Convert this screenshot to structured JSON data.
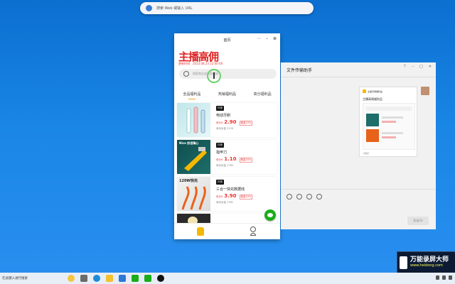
{
  "topbar": {
    "placeholder": "搜索 Web 或输入 URL"
  },
  "miniprogram": {
    "window_title": "首页",
    "logo": "主播高佣",
    "subtitle": "更新时间：2023.08.23 22:00:00",
    "search_placeholder": "搜索商品或粘贴链接",
    "tabs": [
      "全品福利品",
      "热销福利品",
      "高分福利品"
    ],
    "products": [
      {
        "badge": "抖音",
        "name": "电动牙刷",
        "price_label": "低价¥",
        "price": "2.90",
        "commission": "佣金10%",
        "sales": "库存余量 2228",
        "image_overlay": ""
      },
      {
        "badge": "抖音",
        "name": "指甲刀",
        "price_label": "低价¥",
        "price": "1.10",
        "commission": "佣金15%",
        "sales": "库存余量 1780",
        "image_overlay": "Nice 舒适精心"
      },
      {
        "badge": "抖音",
        "name": "三合一快充数据线",
        "price_label": "低价¥",
        "price": "3.90",
        "commission": "佣金10%",
        "sales": "库存余量 1382",
        "image_overlay": "120W快充"
      }
    ]
  },
  "chat": {
    "title": "文件传输助手",
    "card_header": "主播高佣福利品",
    "card_title": "主播高佣福利品",
    "card_footer": "小程序",
    "send_label": "发送(S)"
  },
  "watermark": {
    "line1": "万能录屏大师",
    "line2": "www.heidong.com"
  },
  "taskbar": {
    "search_text": "在此键入进行搜索"
  },
  "colors": {
    "accent_red": "#e33",
    "accent_yellow": "#f5b800",
    "wechat_green": "#1aad19",
    "desktop_blue": "#1a86e6"
  }
}
